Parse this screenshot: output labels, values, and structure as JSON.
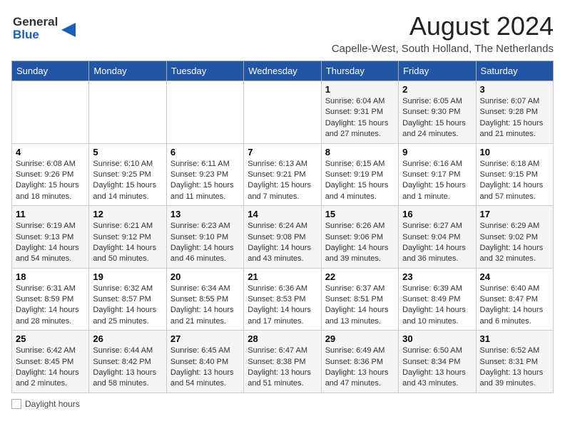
{
  "header": {
    "logo_line1": "General",
    "logo_line2": "Blue",
    "month_title": "August 2024",
    "location": "Capelle-West, South Holland, The Netherlands"
  },
  "columns": [
    "Sunday",
    "Monday",
    "Tuesday",
    "Wednesday",
    "Thursday",
    "Friday",
    "Saturday"
  ],
  "weeks": [
    [
      {
        "day": "",
        "info": ""
      },
      {
        "day": "",
        "info": ""
      },
      {
        "day": "",
        "info": ""
      },
      {
        "day": "",
        "info": ""
      },
      {
        "day": "1",
        "info": "Sunrise: 6:04 AM\nSunset: 9:31 PM\nDaylight: 15 hours and 27 minutes."
      },
      {
        "day": "2",
        "info": "Sunrise: 6:05 AM\nSunset: 9:30 PM\nDaylight: 15 hours and 24 minutes."
      },
      {
        "day": "3",
        "info": "Sunrise: 6:07 AM\nSunset: 9:28 PM\nDaylight: 15 hours and 21 minutes."
      }
    ],
    [
      {
        "day": "4",
        "info": "Sunrise: 6:08 AM\nSunset: 9:26 PM\nDaylight: 15 hours and 18 minutes."
      },
      {
        "day": "5",
        "info": "Sunrise: 6:10 AM\nSunset: 9:25 PM\nDaylight: 15 hours and 14 minutes."
      },
      {
        "day": "6",
        "info": "Sunrise: 6:11 AM\nSunset: 9:23 PM\nDaylight: 15 hours and 11 minutes."
      },
      {
        "day": "7",
        "info": "Sunrise: 6:13 AM\nSunset: 9:21 PM\nDaylight: 15 hours and 7 minutes."
      },
      {
        "day": "8",
        "info": "Sunrise: 6:15 AM\nSunset: 9:19 PM\nDaylight: 15 hours and 4 minutes."
      },
      {
        "day": "9",
        "info": "Sunrise: 6:16 AM\nSunset: 9:17 PM\nDaylight: 15 hours and 1 minute."
      },
      {
        "day": "10",
        "info": "Sunrise: 6:18 AM\nSunset: 9:15 PM\nDaylight: 14 hours and 57 minutes."
      }
    ],
    [
      {
        "day": "11",
        "info": "Sunrise: 6:19 AM\nSunset: 9:13 PM\nDaylight: 14 hours and 54 minutes."
      },
      {
        "day": "12",
        "info": "Sunrise: 6:21 AM\nSunset: 9:12 PM\nDaylight: 14 hours and 50 minutes."
      },
      {
        "day": "13",
        "info": "Sunrise: 6:23 AM\nSunset: 9:10 PM\nDaylight: 14 hours and 46 minutes."
      },
      {
        "day": "14",
        "info": "Sunrise: 6:24 AM\nSunset: 9:08 PM\nDaylight: 14 hours and 43 minutes."
      },
      {
        "day": "15",
        "info": "Sunrise: 6:26 AM\nSunset: 9:06 PM\nDaylight: 14 hours and 39 minutes."
      },
      {
        "day": "16",
        "info": "Sunrise: 6:27 AM\nSunset: 9:04 PM\nDaylight: 14 hours and 36 minutes."
      },
      {
        "day": "17",
        "info": "Sunrise: 6:29 AM\nSunset: 9:02 PM\nDaylight: 14 hours and 32 minutes."
      }
    ],
    [
      {
        "day": "18",
        "info": "Sunrise: 6:31 AM\nSunset: 8:59 PM\nDaylight: 14 hours and 28 minutes."
      },
      {
        "day": "19",
        "info": "Sunrise: 6:32 AM\nSunset: 8:57 PM\nDaylight: 14 hours and 25 minutes."
      },
      {
        "day": "20",
        "info": "Sunrise: 6:34 AM\nSunset: 8:55 PM\nDaylight: 14 hours and 21 minutes."
      },
      {
        "day": "21",
        "info": "Sunrise: 6:36 AM\nSunset: 8:53 PM\nDaylight: 14 hours and 17 minutes."
      },
      {
        "day": "22",
        "info": "Sunrise: 6:37 AM\nSunset: 8:51 PM\nDaylight: 14 hours and 13 minutes."
      },
      {
        "day": "23",
        "info": "Sunrise: 6:39 AM\nSunset: 8:49 PM\nDaylight: 14 hours and 10 minutes."
      },
      {
        "day": "24",
        "info": "Sunrise: 6:40 AM\nSunset: 8:47 PM\nDaylight: 14 hours and 6 minutes."
      }
    ],
    [
      {
        "day": "25",
        "info": "Sunrise: 6:42 AM\nSunset: 8:45 PM\nDaylight: 14 hours and 2 minutes."
      },
      {
        "day": "26",
        "info": "Sunrise: 6:44 AM\nSunset: 8:42 PM\nDaylight: 13 hours and 58 minutes."
      },
      {
        "day": "27",
        "info": "Sunrise: 6:45 AM\nSunset: 8:40 PM\nDaylight: 13 hours and 54 minutes."
      },
      {
        "day": "28",
        "info": "Sunrise: 6:47 AM\nSunset: 8:38 PM\nDaylight: 13 hours and 51 minutes."
      },
      {
        "day": "29",
        "info": "Sunrise: 6:49 AM\nSunset: 8:36 PM\nDaylight: 13 hours and 47 minutes."
      },
      {
        "day": "30",
        "info": "Sunrise: 6:50 AM\nSunset: 8:34 PM\nDaylight: 13 hours and 43 minutes."
      },
      {
        "day": "31",
        "info": "Sunrise: 6:52 AM\nSunset: 8:31 PM\nDaylight: 13 hours and 39 minutes."
      }
    ]
  ],
  "legend": {
    "daylight_label": "Daylight hours"
  }
}
